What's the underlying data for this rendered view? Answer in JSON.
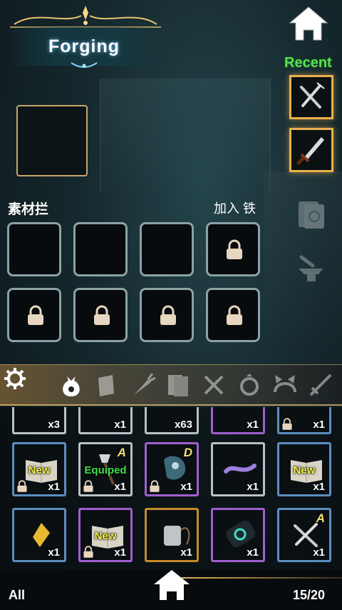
{
  "header": {
    "title": "Forging"
  },
  "recent": {
    "label": "Recent",
    "items": [
      {
        "icon": "fork-knife-icon"
      },
      {
        "icon": "dagger-icon"
      }
    ]
  },
  "materials": {
    "label": "素材拦",
    "add_text": "加入 铁",
    "slots": 8,
    "locked_from": 3
  },
  "categories": [
    "bag-icon",
    "scroll-icon",
    "carrot-icon",
    "book-icon",
    "fork-knife-icon",
    "ring-icon",
    "cat-ears-icon",
    "sword-icon"
  ],
  "inventory": {
    "row0": [
      "x3",
      "x1",
      "x63",
      "x1",
      "x1"
    ],
    "row1": [
      {
        "count": "x1",
        "tag": "New",
        "locked": true,
        "icon": "open-book-icon",
        "color": "blue"
      },
      {
        "count": "x1",
        "tag": "Equiped",
        "grade": "A",
        "locked": true,
        "icon": "axe-icon",
        "color": "white"
      },
      {
        "count": "x1",
        "grade": "D",
        "locked": true,
        "icon": "gauntlet-icon",
        "color": "purple"
      },
      {
        "count": "x1",
        "icon": "ribbon-icon",
        "color": "white"
      },
      {
        "count": "x1",
        "tag": "New",
        "icon": "open-book-icon",
        "color": "blue"
      }
    ],
    "row2": [
      {
        "count": "x1",
        "icon": "crystal-icon",
        "color": "blue"
      },
      {
        "count": "x1",
        "tag": "New",
        "locked": true,
        "icon": "open-book-icon",
        "color": "purple"
      },
      {
        "count": "x1",
        "icon": "thread-spool-icon",
        "color": "gold"
      },
      {
        "count": "x1",
        "icon": "rune-scroll-icon",
        "color": "purple"
      },
      {
        "count": "x1",
        "grade": "A",
        "icon": "fork-knife-icon",
        "color": "blue"
      }
    ]
  },
  "footer": {
    "filter": "All",
    "capacity": "15/20"
  }
}
